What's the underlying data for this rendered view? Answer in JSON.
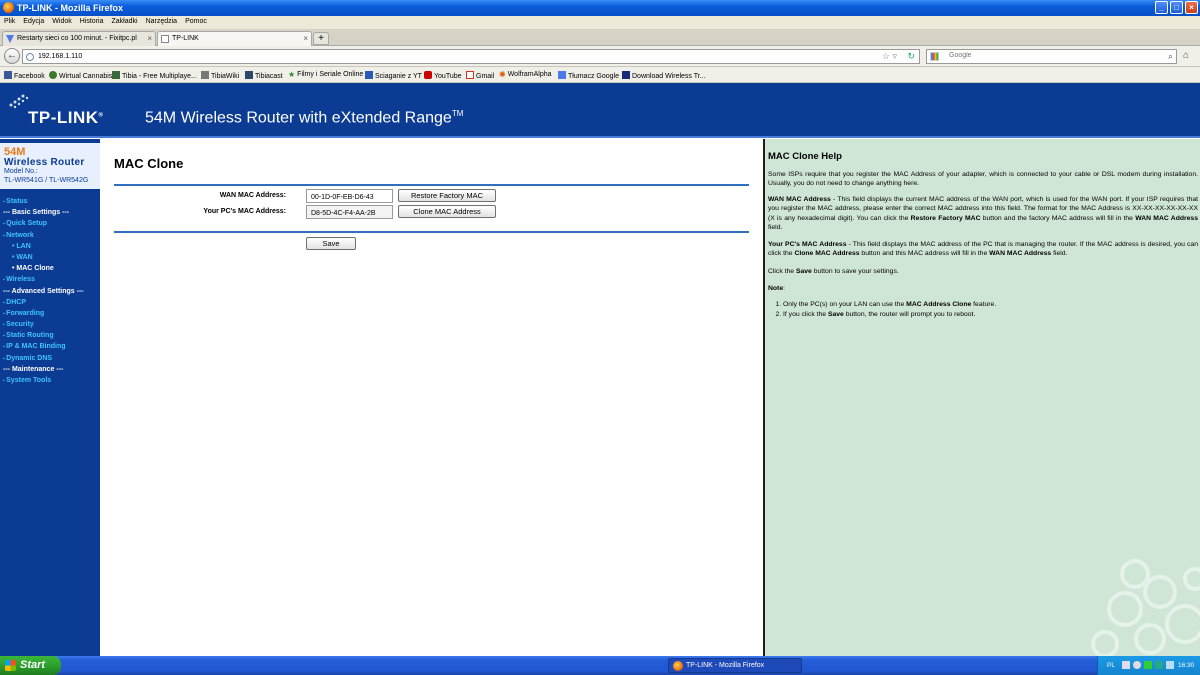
{
  "window": {
    "title": "TP-LINK - Mozilla Firefox",
    "controls": [
      "_",
      "□",
      "×"
    ]
  },
  "menubar": [
    "Plik",
    "Edycja",
    "Widok",
    "Historia",
    "Zakładki",
    "Narzędzia",
    "Pomoc"
  ],
  "tabs": [
    {
      "label": "Restarty sieci co 100 minut. - Fixitpc.pl",
      "close": "×"
    },
    {
      "label": "TP-LINK",
      "close": "×"
    }
  ],
  "newtab_label": "+",
  "navbar": {
    "url": "192.168.1.110",
    "search_placeholder": "Google",
    "back_glyph": "←"
  },
  "bookmarks": [
    {
      "label": "Facebook",
      "color": "#3b5998"
    },
    {
      "label": "Wirtual Cannabis",
      "color": "#3a7a2a"
    },
    {
      "label": "Tibia - Free Multiplaye...",
      "color": "#3a6a3a"
    },
    {
      "label": "TibiaWiki",
      "color": "#777777"
    },
    {
      "label": "Tibiacast",
      "color": "#2a4a6a"
    },
    {
      "label": "Filmy i Seriale Online",
      "color": "#2a8a2a"
    },
    {
      "label": "Sciaganie z YT",
      "color": "#2a5ab8"
    },
    {
      "label": "YouTube",
      "color": "#cc0000"
    },
    {
      "label": "Gmail",
      "color": "#d93025"
    },
    {
      "label": "WolframAlpha",
      "color": "#dd5500"
    },
    {
      "label": "Tłumacz Google",
      "color": "#4a7be8"
    },
    {
      "label": "Download Wireless Tr...",
      "color": "#1a2a7a"
    }
  ],
  "banner": {
    "logo": "TP-LINK",
    "logo_mark": "®",
    "slogan": "54M Wireless Router with eXtended Range",
    "slogan_tm": "TM"
  },
  "model": {
    "line1": "54M",
    "line2": "Wireless  Router",
    "line3": "Model No.:",
    "line4": "TL-WR541G / TL-WR542G"
  },
  "sidebar_menu": [
    {
      "label": "Status",
      "kind": "item"
    },
    {
      "label": "--- Basic Settings ---",
      "kind": "section"
    },
    {
      "label": "Quick Setup",
      "kind": "item"
    },
    {
      "label": "Network",
      "kind": "item"
    },
    {
      "label": "LAN",
      "kind": "sub"
    },
    {
      "label": "WAN",
      "kind": "sub"
    },
    {
      "label": "MAC Clone",
      "kind": "sub-current"
    },
    {
      "label": "Wireless",
      "kind": "item"
    },
    {
      "label": "--- Advanced Settings ---",
      "kind": "section"
    },
    {
      "label": "DHCP",
      "kind": "item"
    },
    {
      "label": "Forwarding",
      "kind": "item"
    },
    {
      "label": "Security",
      "kind": "item"
    },
    {
      "label": "Static Routing",
      "kind": "item"
    },
    {
      "label": "IP & MAC Binding",
      "kind": "item"
    },
    {
      "label": "Dynamic DNS",
      "kind": "item"
    },
    {
      "label": "--- Maintenance ---",
      "kind": "section"
    },
    {
      "label": "System Tools",
      "kind": "item"
    }
  ],
  "main": {
    "title": "MAC Clone",
    "wan_label": "WAN MAC Address:",
    "wan_value": "00-1D-0F-EB-D6-43",
    "restore_button": "Restore Factory MAC",
    "pc_label": "Your PC's MAC Address:",
    "pc_value": "D8-5D-4C-F4-AA-2B",
    "clone_button": "Clone MAC Address",
    "save_button": "Save"
  },
  "help": {
    "title": "MAC Clone Help",
    "intro": "Some ISPs require that you register the MAC Address of your adapter, which is connected to your cable or DSL modem during installation. Usually, you do not need to change anything here.",
    "wan_term": "WAN MAC Address",
    "wan_text_1": " - This field displays the current MAC address of the WAN port, which is used for the WAN port. If your ISP requires that you register the MAC address, please enter the correct MAC address into this field. The format for the MAC Address is XX-XX-XX-XX-XX-XX (X is any hexadecimal digit). You can click the ",
    "wan_bold_1": "Restore Factory MAC",
    "wan_text_2": " button and the factory MAC address will fill in the ",
    "wan_bold_2": "WAN MAC Address",
    "wan_text_3": " field.",
    "pc_term": "Your PC's MAC Address",
    "pc_text_1": " - This field displays the MAC address of the PC that is managing the router. If the MAC address is desired, you can click the ",
    "pc_bold_1": "Clone MAC Address",
    "pc_text_2": " button and this MAC address will fill in the ",
    "pc_bold_2": "WAN MAC Address",
    "pc_text_3": " field.",
    "save_text_1": "Click the ",
    "save_bold": "Save",
    "save_text_2": " button to save your settings.",
    "note_label": "Note",
    "note_colon": ":",
    "note1_text_1": "Only the PC(s) on your LAN can use the ",
    "note1_bold": "MAC Address Clone",
    "note1_text_2": " feature.",
    "note2_text_1": "If you click the ",
    "note2_bold": "Save",
    "note2_text_2": " button, the router will prompt you to reboot."
  },
  "taskbar": {
    "start_label": "Start",
    "task_label": "TP-LINK - Mozilla Firefox",
    "language": "PL",
    "clock": "16:30"
  }
}
